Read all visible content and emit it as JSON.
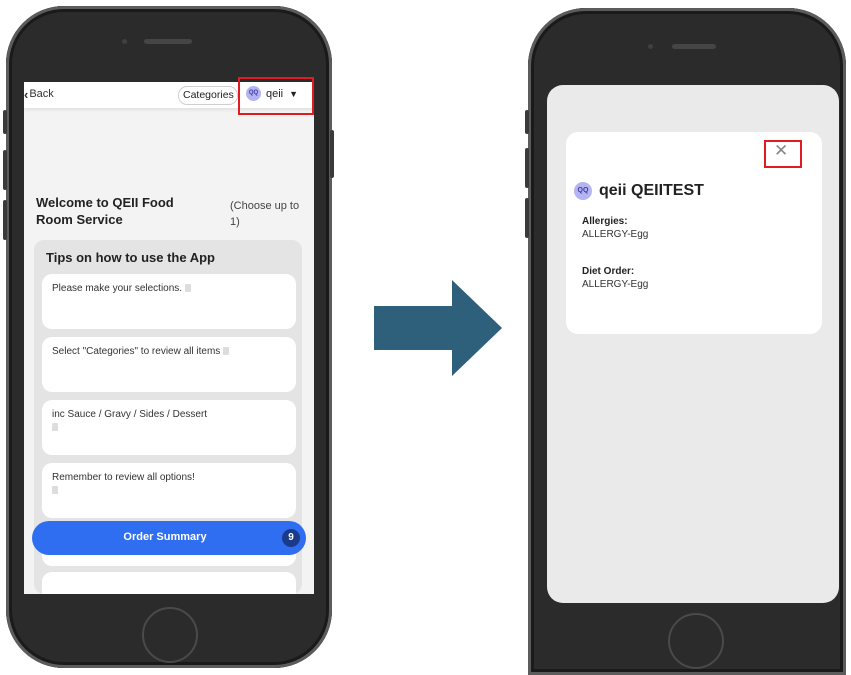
{
  "left_phone": {
    "top_bar": {
      "back_label": "Back",
      "categories_label": "Categories",
      "avatar_initials": "QQ",
      "user_name": "qeii"
    },
    "welcome_title": "Welcome to QEII Food Room Service",
    "choose_hint": "(Choose up to 1)",
    "tips": {
      "title": "Tips on how to use the App",
      "items": [
        "Please make your selections.",
        "Select \"Categories\" to review all items",
        "inc Sauce / Gravy / Sides / Dessert",
        "Remember to review all options!"
      ]
    },
    "order_summary": {
      "label": "Order Summary",
      "count": "9"
    }
  },
  "right_phone": {
    "modal": {
      "avatar_initials": "QQ",
      "patient_name": "qeii QEIITEST",
      "allergies_label": "Allergies:",
      "allergies_value": "ALLERGY-Egg",
      "diet_order_label": "Diet Order:",
      "diet_order_value": "ALLERGY-Egg",
      "close_symbol": "✕"
    }
  },
  "colors": {
    "highlight_box": "#e11b22",
    "arrow": "#2e5f7b",
    "order_bar": "#2f6ef0",
    "avatar": "#b4b4f2"
  }
}
